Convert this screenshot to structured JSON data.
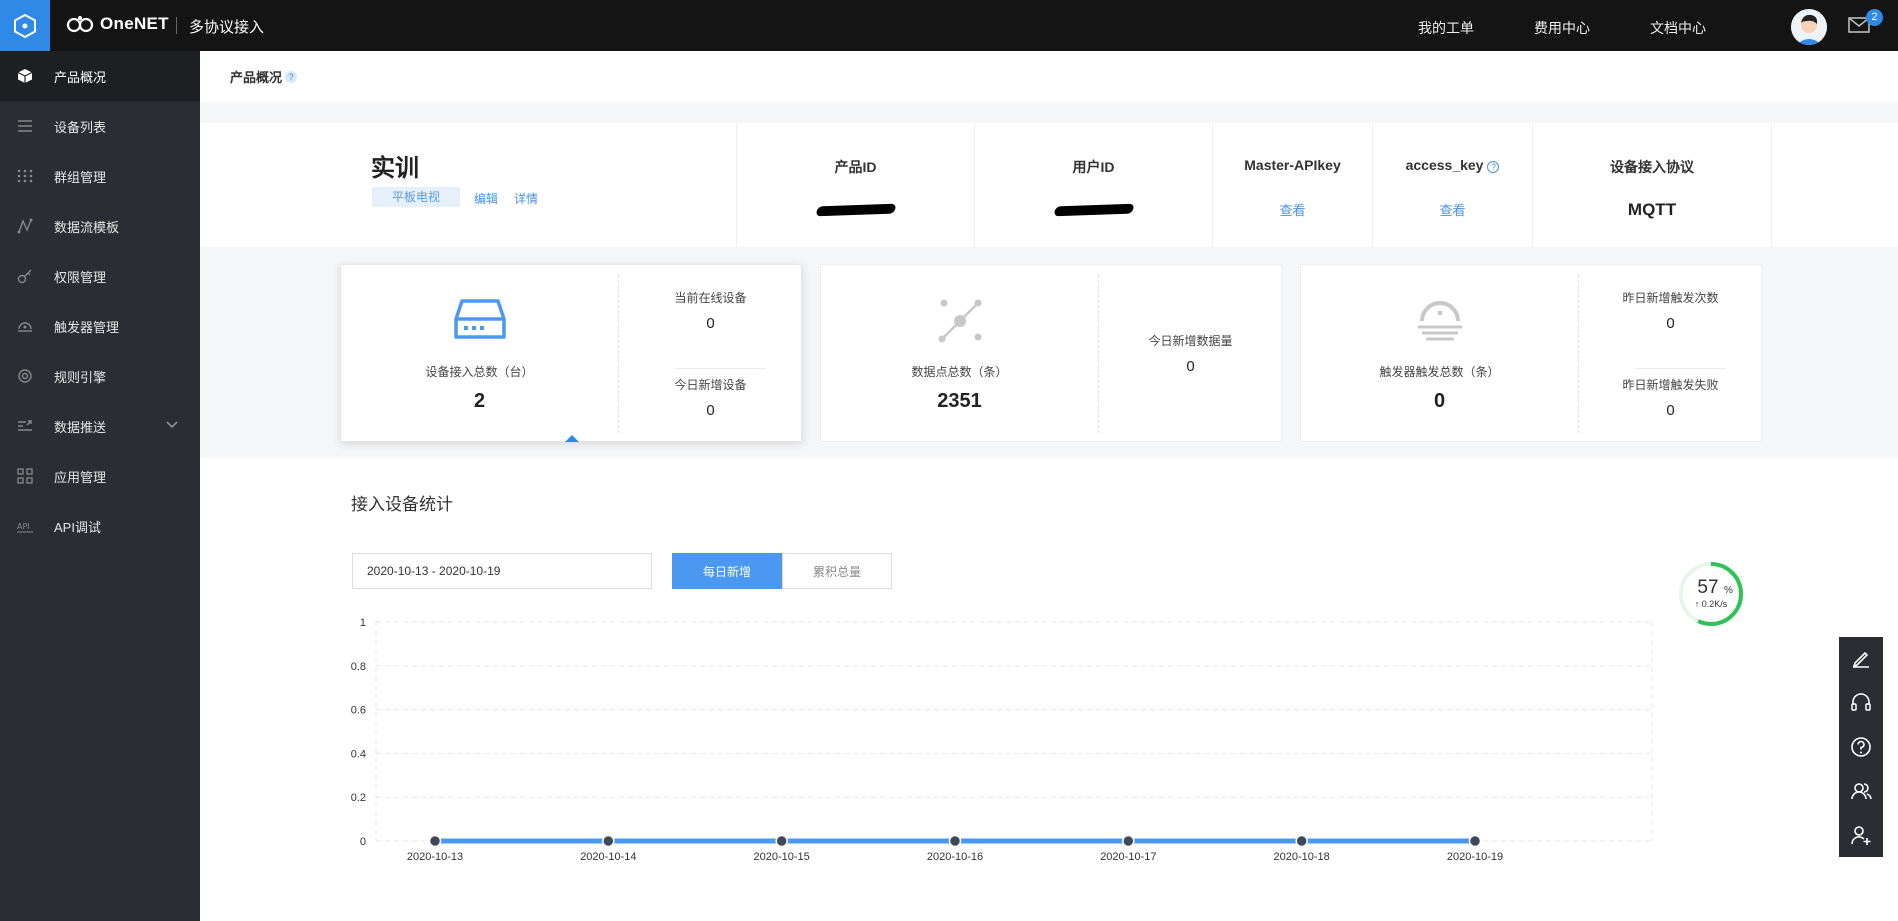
{
  "topbar": {
    "brand": "OneNET",
    "app_title": "多协议接入",
    "links": [
      "我的工单",
      "费用中心",
      "文档中心"
    ],
    "mail_badge": "2"
  },
  "sidebar": {
    "items": [
      {
        "label": "产品概况",
        "icon": "cube-icon"
      },
      {
        "label": "设备列表",
        "icon": "list-icon"
      },
      {
        "label": "群组管理",
        "icon": "grid-dots-icon"
      },
      {
        "label": "数据流模板",
        "icon": "flow-icon"
      },
      {
        "label": "权限管理",
        "icon": "key-icon"
      },
      {
        "label": "触发器管理",
        "icon": "trigger-icon"
      },
      {
        "label": "规则引擎",
        "icon": "rule-icon"
      },
      {
        "label": "数据推送",
        "icon": "push-icon"
      },
      {
        "label": "应用管理",
        "icon": "apps-icon"
      },
      {
        "label": "API调试",
        "icon": "api-icon"
      }
    ]
  },
  "breadcrumb": {
    "title": "产品概况",
    "help": "?"
  },
  "product": {
    "name": "实训",
    "type_tag": "平板电视",
    "edit": "编辑",
    "detail": "详情",
    "columns": {
      "product_id_label": "产品ID",
      "user_id_label": "用户ID",
      "master_apikey_label": "Master-APIkey",
      "master_apikey_action": "查看",
      "access_key_label": "access_key",
      "access_key_help": "?",
      "access_key_action": "查看",
      "protocol_label": "设备接入协议",
      "protocol_value": "MQTT"
    }
  },
  "cards": {
    "devices": {
      "label": "设备接入总数（台）",
      "value": "2",
      "online_label": "当前在线设备",
      "online_value": "0",
      "new_label": "今日新增设备",
      "new_value": "0"
    },
    "datapoints": {
      "label": "数据点总数（条）",
      "value": "2351",
      "new_label": "今日新增数据量",
      "new_value": "0"
    },
    "triggers": {
      "label": "触发器触发总数（条）",
      "value": "0",
      "yesterday_label": "昨日新增触发次数",
      "yesterday_value": "0",
      "fail_label": "昨日新增触发失败",
      "fail_value": "0"
    }
  },
  "stats": {
    "title": "接入设备统计",
    "date_range": "2020-10-13 - 2020-10-19",
    "tab_daily": "每日新增",
    "tab_total": "累积总量"
  },
  "gauge": {
    "value": "57",
    "unit": "%",
    "rate": "↑ 0.2K/s",
    "fraction": 0.57
  },
  "colors": {
    "accent": "#2e8ae6",
    "series": "#4a98f0",
    "sidebar": "#2b2d33",
    "topbar": "#141414"
  },
  "chart_data": {
    "type": "line",
    "categories": [
      "2020-10-13",
      "2020-10-14",
      "2020-10-15",
      "2020-10-16",
      "2020-10-17",
      "2020-10-18",
      "2020-10-19"
    ],
    "values": [
      0,
      0,
      0,
      0,
      0,
      0,
      0
    ],
    "ylim": [
      0,
      1
    ],
    "yticks": [
      "0",
      "0.2",
      "0.4",
      "0.6",
      "0.8",
      "1"
    ],
    "grid": true
  },
  "fab": [
    "edit-icon",
    "headset-icon",
    "help-icon",
    "community-icon",
    "add-user-icon"
  ]
}
